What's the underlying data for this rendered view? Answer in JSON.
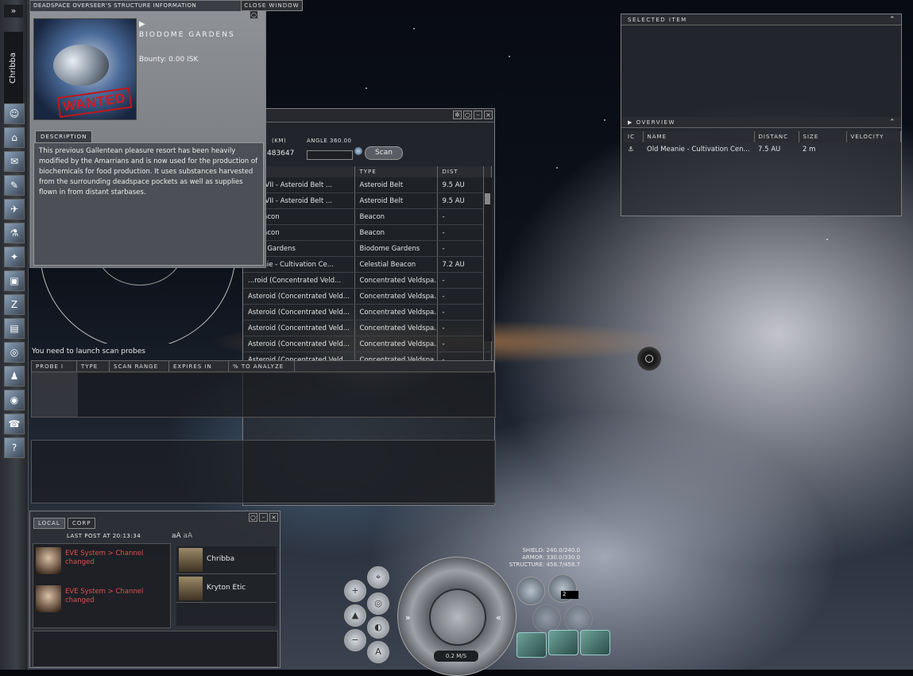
{
  "neocom": {
    "expand_label": "»",
    "character_name": "Chribba",
    "buttons": [
      "character-sheet",
      "assets",
      "mail",
      "notepad",
      "fleet",
      "science",
      "map",
      "cargo",
      "market",
      "wallet",
      "journal",
      "corporation",
      "people",
      "channels",
      "help"
    ]
  },
  "info_window": {
    "title": "DEADSPACE OVERSEER'S STRUCTURE INFORMATION",
    "close_label": "CLOSE WINDOW",
    "stamp": "WANTED",
    "object_name": "BIODOME GARDENS",
    "bounty": "Bounty: 0.00 ISK",
    "tab_label": "DESCRIPTION",
    "description": "This previous Gallentean pleasure resort has been heavily modified by the Amarrians and is now used for the production of biochemicals for food production. It uses substances harvested from the surrounding deadspace pockets as well as supplies flown in from distant starbases."
  },
  "scanner": {
    "range_label": "(KM)",
    "range_value": "483647",
    "angle_label": "ANGLE 360.00",
    "scan_button": "Scan",
    "columns": [
      "",
      "TYPE",
      "DIST"
    ],
    "rows": [
      [
        "...ah VII - Asteroid Belt ...",
        "Asteroid Belt",
        "9.5 AU"
      ],
      [
        "...ah VII - Asteroid Belt ...",
        "Asteroid Belt",
        "9.5 AU"
      ],
      [
        "...Beacon",
        "Beacon",
        "-"
      ],
      [
        "...Beacon",
        "Beacon",
        "-"
      ],
      [
        "...me Gardens",
        "Biodome Gardens",
        "-"
      ],
      [
        "...eanie - Cultivation Ce...",
        "Celestial Beacon",
        "7.2 AU"
      ],
      [
        "...roid (Concentrated Veld...",
        "Concentrated Veldspa...",
        "-"
      ],
      [
        "Asteroid (Concentrated Veld...",
        "Concentrated Veldspa...",
        "-"
      ],
      [
        "Asteroid (Concentrated Veld...",
        "Concentrated Veldspa...",
        "-"
      ],
      [
        "Asteroid (Concentrated Veld...",
        "Concentrated Veldspa...",
        "-"
      ],
      [
        "Asteroid (Concentrated Veld...",
        "Concentrated Veldspa...",
        "-"
      ],
      [
        "Asteroid (Concentrated Veld...",
        "Concentrated Veldspa...",
        "-"
      ]
    ],
    "probe_message": "You need to launch scan probes",
    "probe_columns": [
      "PROBE I",
      "TYPE",
      "SCAN RANGE",
      "EXPIRES IN",
      "% TO ANALYZE"
    ]
  },
  "selected_item": {
    "title": "SELECTED ITEM",
    "overview_title": "OVERVIEW",
    "overview_columns": [
      "IC",
      "NAME",
      "DISTANC",
      "SIZE",
      "VELOCITY"
    ],
    "overview_rows": [
      [
        "",
        "Old Meanie - Cultivation Cen...",
        "7.5 AU",
        "2 m",
        ""
      ]
    ]
  },
  "chat": {
    "tabs": [
      "LOCAL",
      "CORP"
    ],
    "last_post": "LAST POST AT 20:13:34",
    "font_large": "aA",
    "font_small": "aA",
    "messages": [
      "EVE System > Channel changed",
      "EVE System > Channel changed"
    ],
    "members": [
      "Chribba",
      "Kryton Etic"
    ]
  },
  "hud": {
    "shield": "SHIELD: 240.0/240.0",
    "armor": "ARMOR: 330.0/330.0",
    "structure": "STRUCTURE: 458.7/458.7",
    "speed": "0.2 M/S",
    "drone_count": "2"
  }
}
